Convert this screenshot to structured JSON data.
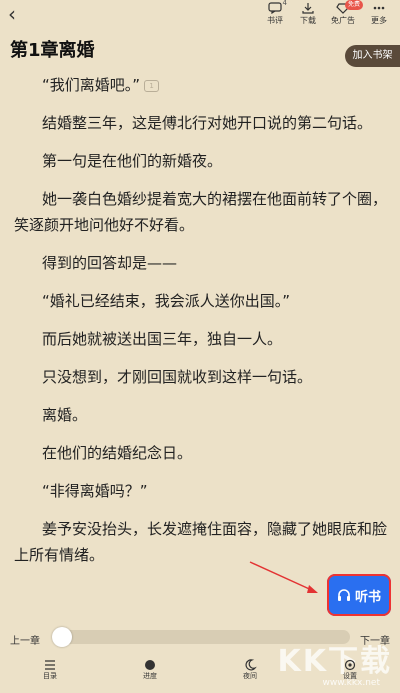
{
  "topbar": {
    "back_icon": "chevron-left-icon",
    "comments": {
      "label": "书评",
      "count": "4"
    },
    "download": {
      "label": "下载"
    },
    "no_ads": {
      "label": "免广告",
      "badge": "免费"
    },
    "more": {
      "label": "更多"
    }
  },
  "chapter": {
    "title": "第1章离婚",
    "add_shelf_label": "加入书架"
  },
  "paragraphs": [
    "“我们离婚吧。”",
    "结婚整三年，这是傅北行对她开口说的第二句话。",
    "第一句是在他们的新婚夜。",
    "她一袭白色婚纱提着宽大的裙摆在他面前转了个圈，笑逐颜开地问他好不好看。",
    "得到的回答却是——",
    "“婚礼已经结束，我会派人送你出国。”",
    "而后她就被送出国三年，独自一人。",
    "只没想到，才刚回国就收到这样一句话。",
    "离婚。",
    "在他们的结婚纪念日。",
    "“非得离婚吗？”",
    "姜予安没抬头，长发遮掩住面容，隐藏了她眼底和脸上所有情绪。"
  ],
  "comment_badge": "1",
  "listen_button": {
    "label": "听书",
    "icon": "headphones-icon"
  },
  "progress": {
    "prev_label": "上一章",
    "next_label": "下一章",
    "value": 0.0
  },
  "bottombar": {
    "items": [
      {
        "label": "目录",
        "icon": "menu-icon"
      },
      {
        "label": "进度",
        "icon": "progress-icon"
      },
      {
        "label": "夜间",
        "icon": "moon-icon"
      },
      {
        "label": "设置",
        "icon": "settings-icon"
      }
    ]
  },
  "watermark": {
    "text": "KK下载",
    "url": "www.kkx.net"
  },
  "colors": {
    "background": "#ece1c8",
    "accent": "#2a6ff0",
    "arrow": "#e33333"
  }
}
